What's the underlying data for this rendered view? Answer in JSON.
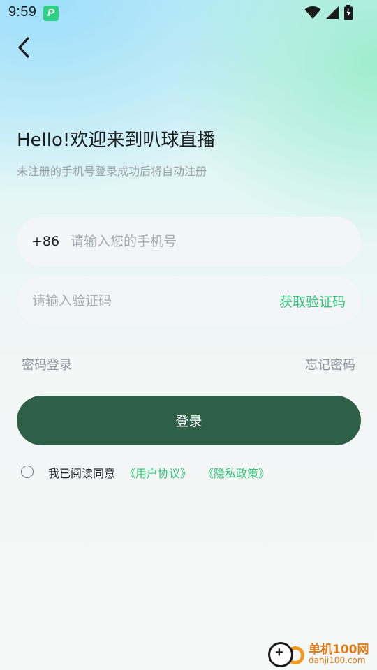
{
  "status_bar": {
    "time": "9:59",
    "app_badge": "P"
  },
  "header": {
    "title": "Hello!欢迎来到叭球直播",
    "subtitle": "未注册的手机号登录成功后将自动注册"
  },
  "phone_field": {
    "country_code": "+86",
    "placeholder": "请输入您的手机号",
    "value": ""
  },
  "code_field": {
    "placeholder": "请输入验证码",
    "value": "",
    "get_code_label": "获取验证码"
  },
  "links": {
    "password_login": "密码登录",
    "forgot_password": "忘记密码"
  },
  "login_button": {
    "label": "登录"
  },
  "agreement": {
    "text": "我已阅读同意",
    "user_agreement": "《用户协议》",
    "privacy_policy": "《隐私政策》",
    "checked": false
  },
  "watermark": {
    "name": "单机100网",
    "domain": "danji100.com"
  },
  "colors": {
    "accent_green": "#2fc57a",
    "button_dark_green": "#2e5f47",
    "placeholder_gray": "#a6abb0"
  },
  "icons": {
    "back": "chevron-left-icon",
    "wifi": "wifi-icon",
    "signal": "signal-icon",
    "battery": "battery-charging-icon"
  }
}
